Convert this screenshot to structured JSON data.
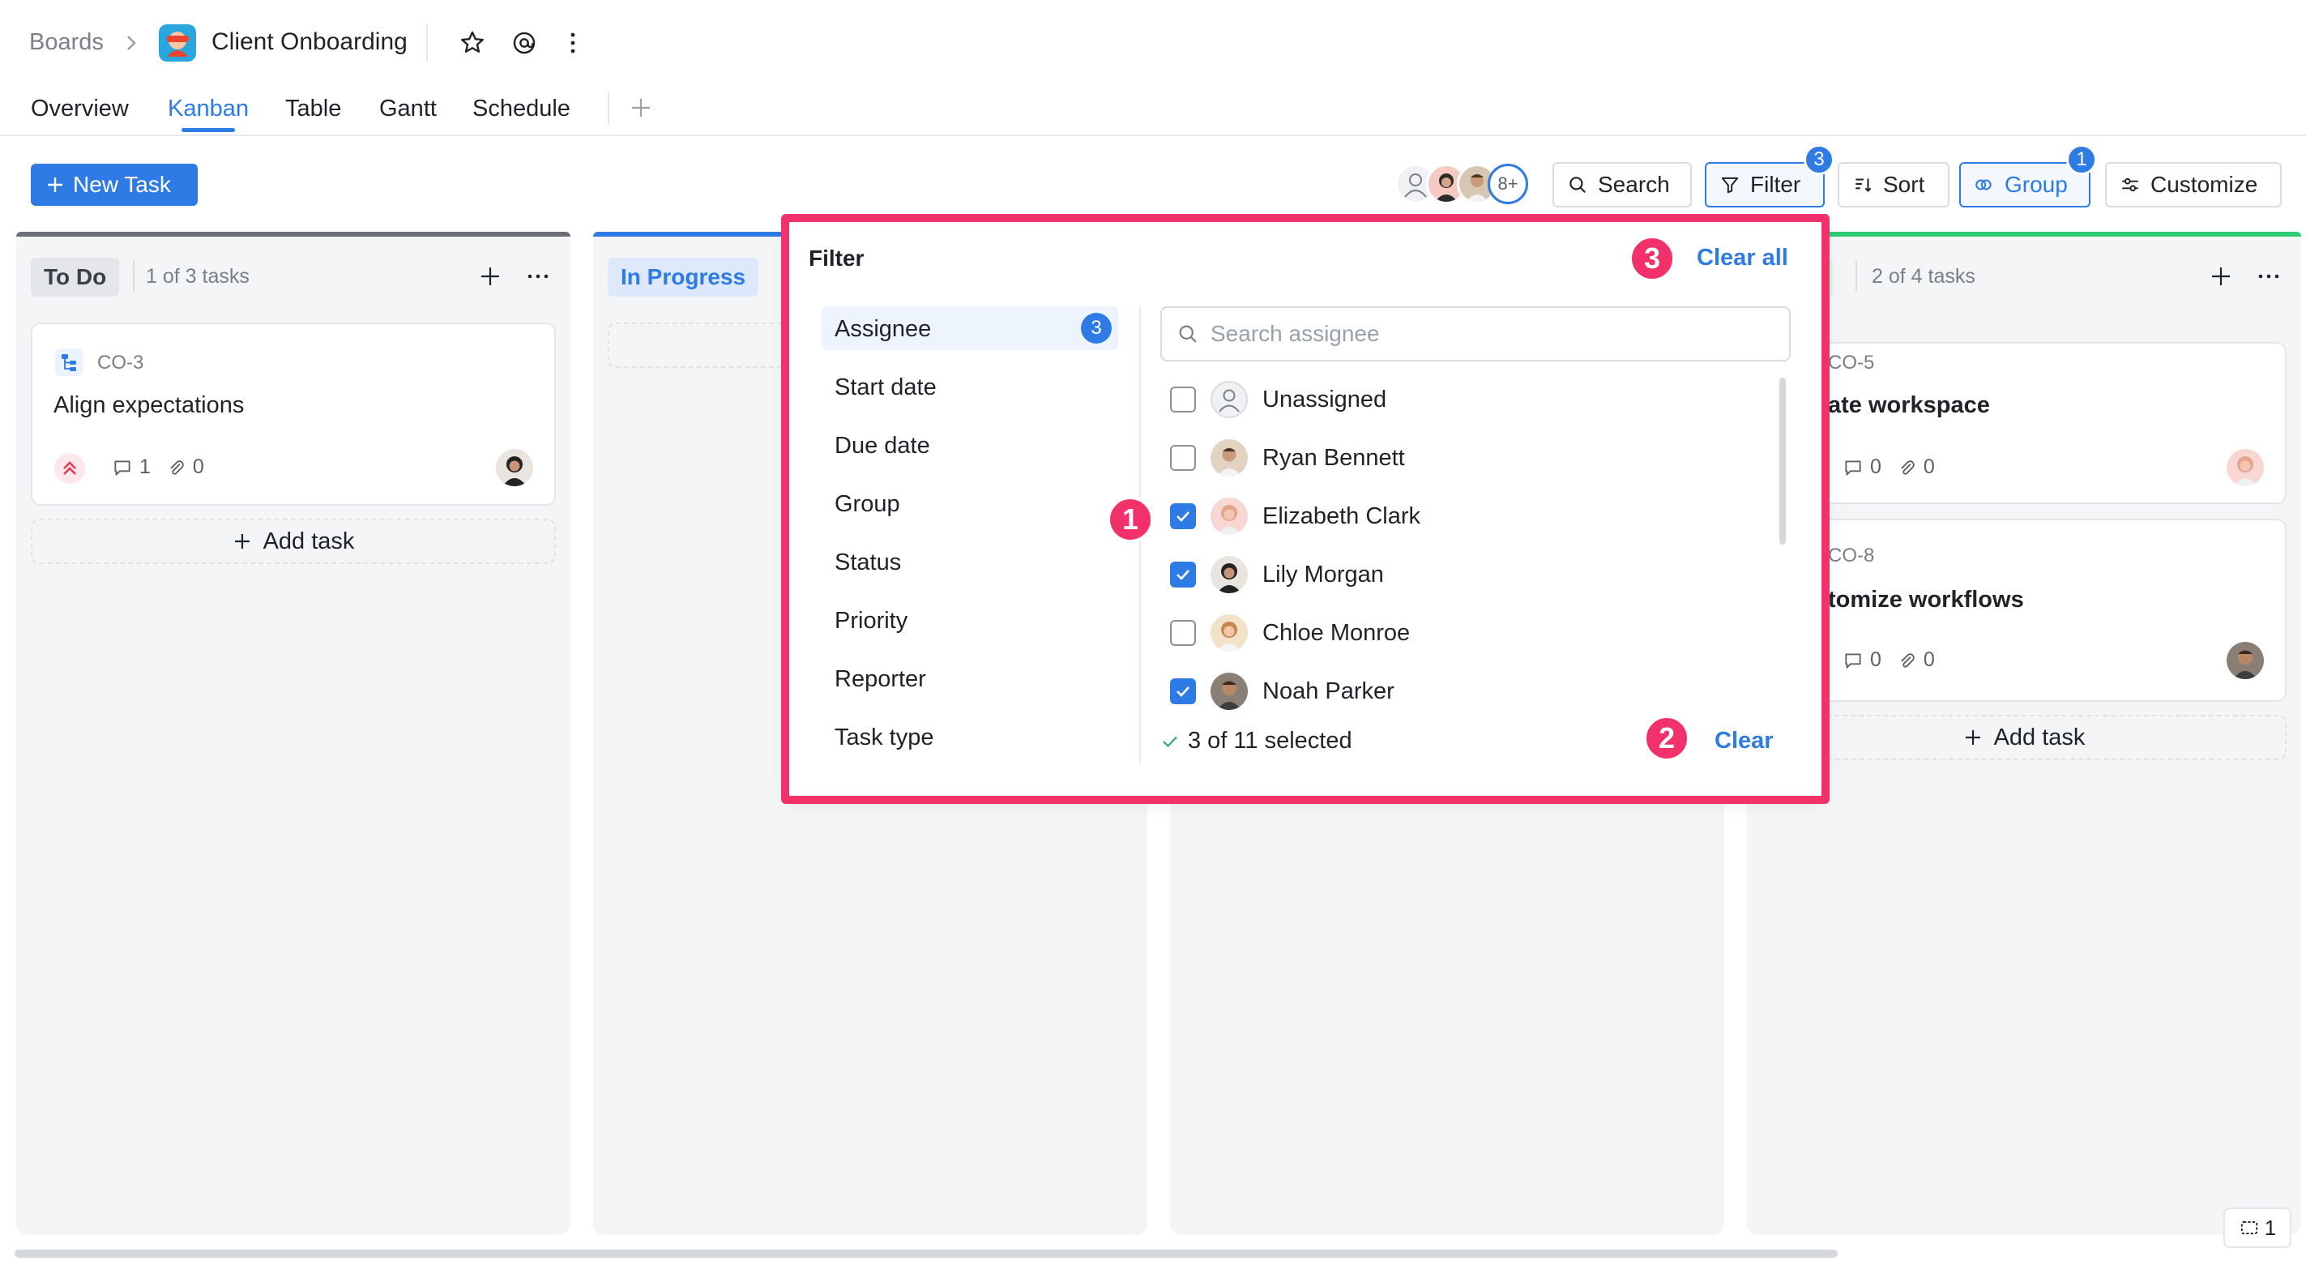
{
  "breadcrumb": {
    "root": "Boards",
    "title": "Client Onboarding"
  },
  "tabs": [
    "Overview",
    "Kanban",
    "Table",
    "Gantt",
    "Schedule"
  ],
  "toolbar": {
    "new_task": "New Task",
    "avatar_overflow": "8+",
    "search": "Search",
    "filter": "Filter",
    "filter_count": "3",
    "sort": "Sort",
    "group": "Group",
    "group_count": "1",
    "customize": "Customize"
  },
  "columns": {
    "todo": {
      "name": "To Do",
      "count": "1 of 3 tasks",
      "card": {
        "id": "CO-3",
        "title": "Align expectations",
        "comments": "1",
        "attachments": "0"
      },
      "add_task": "Add task"
    },
    "in_progress": {
      "name": "In Progress"
    },
    "right": {
      "count": "2 of 4 tasks",
      "cards": [
        {
          "id": "CO-5",
          "title": "ate workspace",
          "comments": "0",
          "attachments": "0"
        },
        {
          "id": "CO-8",
          "title": "tomize workflows",
          "comments": "0",
          "attachments": "0"
        }
      ],
      "add_task": "Add task"
    }
  },
  "filter": {
    "title": "Filter",
    "clear_all": "Clear all",
    "categories": [
      "Assignee",
      "Start date",
      "Due date",
      "Group",
      "Status",
      "Priority",
      "Reporter",
      "Task type"
    ],
    "assignee_count": "3",
    "search_placeholder": "Search assignee",
    "options": [
      {
        "name": "Unassigned",
        "checked": false
      },
      {
        "name": "Ryan Bennett",
        "checked": false
      },
      {
        "name": "Elizabeth Clark",
        "checked": true
      },
      {
        "name": "Lily Morgan",
        "checked": true
      },
      {
        "name": "Chloe Monroe",
        "checked": false
      },
      {
        "name": "Noah Parker",
        "checked": true
      }
    ],
    "selected_summary": "3 of 11 selected",
    "clear": "Clear"
  },
  "callouts": [
    "1",
    "2",
    "3"
  ],
  "corner_chip": "1",
  "colors": {
    "accent": "#2e7be5",
    "callout": "#f2306a",
    "done_green": "#2ecc71"
  }
}
